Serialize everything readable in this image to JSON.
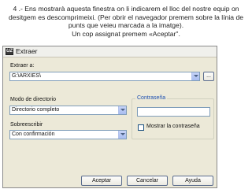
{
  "caption": {
    "line1": "4 .- Ens mostrarà aquesta finestra on li indicarem el lloc del nostre equip on",
    "line2": "desitgem es descomprimeixi. (Per obrir el navegador premem sobre la línia de",
    "line3": "punts que veieu marcada a la imatge).",
    "line4": "Un cop assignat premem «Aceptar\"."
  },
  "window": {
    "title": "Extraer",
    "icon_label": "ÚZ"
  },
  "extract": {
    "label": "Extraer a:",
    "path_value": "G:\\ARXIES\\",
    "browse_label": "..."
  },
  "directory_mode": {
    "label": "Modo de directorio",
    "selected": "Directorio completo"
  },
  "overwrite": {
    "label": "Sobreescribir",
    "selected": "Con confirmación"
  },
  "password": {
    "group_title": "Contraseña",
    "value": "",
    "show_label": "Mostrar la contraseña"
  },
  "buttons": {
    "accept": "Aceptar",
    "cancel": "Cancelar",
    "help": "Ayuda"
  },
  "colors": {
    "input_border": "#7f9db9",
    "window_bg": "#ece9d8",
    "group_title": "#1c4fb0"
  }
}
